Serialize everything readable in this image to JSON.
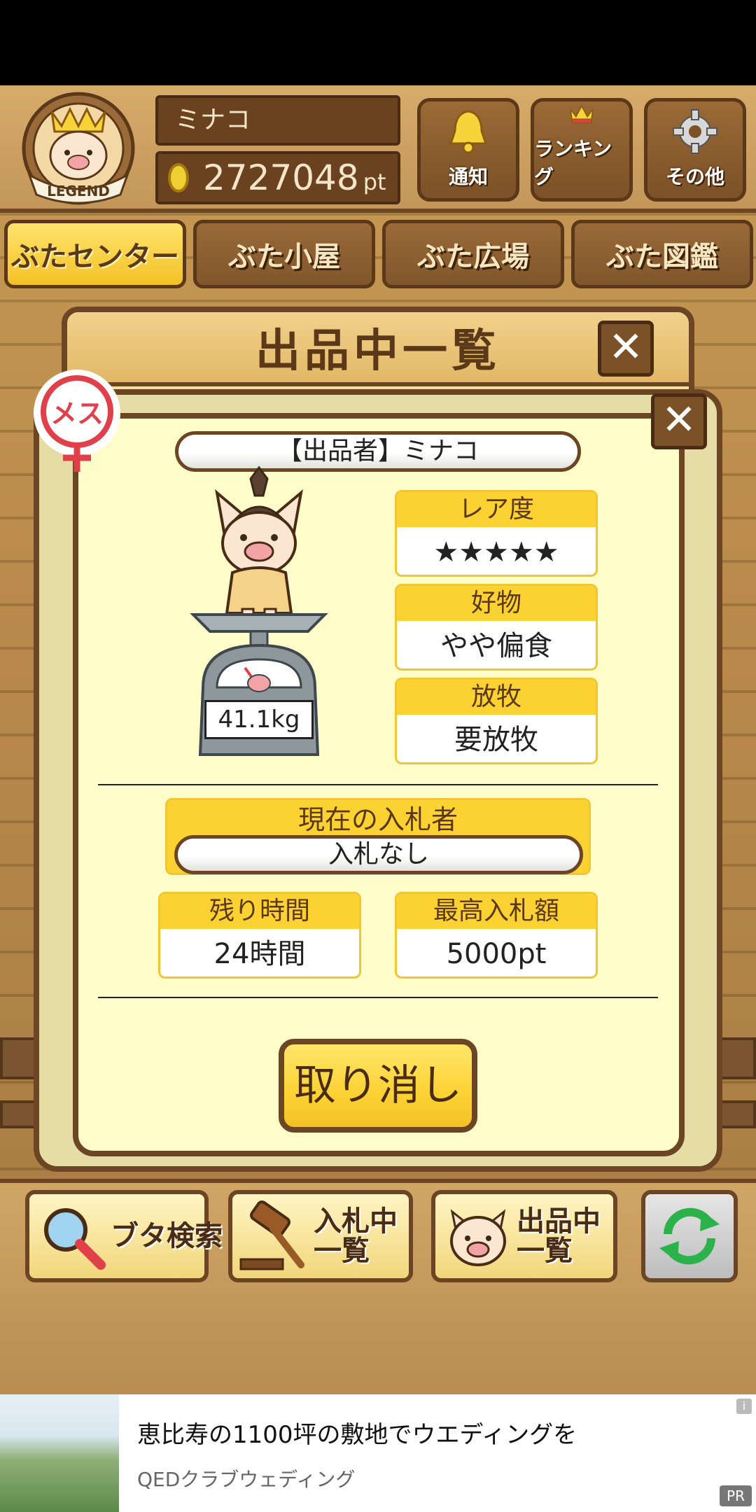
{
  "header": {
    "player_name": "ミナコ",
    "points_value": "2727048",
    "points_unit": "pt",
    "rank_badge": "LEGEND",
    "buttons": [
      {
        "label": "通知",
        "icon": "bell-icon"
      },
      {
        "label": "ランキング",
        "icon": "crown-icon"
      },
      {
        "label": "その他",
        "icon": "gear-icon"
      }
    ]
  },
  "tabs": [
    {
      "label": "ぶたセンター",
      "active": true
    },
    {
      "label": "ぶた小屋",
      "active": false
    },
    {
      "label": "ぶた広場",
      "active": false
    },
    {
      "label": "ぶた図鑑",
      "active": false
    }
  ],
  "back_dialog": {
    "title": "出品中一覧",
    "close": "✕"
  },
  "detail": {
    "close": "✕",
    "gender": "メス",
    "seller_label": "【出品者】ミナコ",
    "weight": "41.1kg",
    "rarity": {
      "header": "レア度",
      "stars": "★★★★★"
    },
    "favorite": {
      "header": "好物",
      "value": "やや偏食"
    },
    "grazing": {
      "header": "放牧",
      "value": "要放牧"
    },
    "current_bidder": {
      "header": "現在の入札者",
      "value": "入札なし"
    },
    "time_left": {
      "header": "残り時間",
      "value": "24時間"
    },
    "highest_bid": {
      "header": "最高入札額",
      "value": "5000pt"
    },
    "cancel_label": "取り消し"
  },
  "bottom_nav": [
    {
      "label": "ブタ検索",
      "icon": "magnifier-icon"
    },
    {
      "label": "入札中\n一覧",
      "icon": "gavel-icon"
    },
    {
      "label": "出品中\n一覧",
      "icon": "pig-face-icon"
    },
    {
      "label": "",
      "icon": "refresh-icon"
    }
  ],
  "ad": {
    "title": "恵比寿の1100坪の敷地でウエディングを",
    "sponsor": "QEDクラブウェディング",
    "info": "i",
    "pr": "PR"
  },
  "colors": {
    "wood": "#b98a4b",
    "dark_brown": "#6b4524",
    "panel_yellow": "#fffdc9",
    "header_yellow": "#fcd233",
    "star": "#ee7a74",
    "gender_red": "#e0404a"
  }
}
